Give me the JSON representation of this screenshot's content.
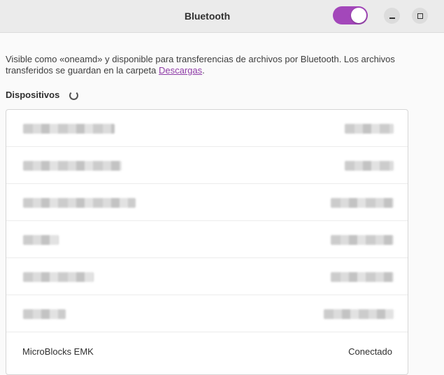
{
  "window": {
    "title": "Bluetooth",
    "toggle_state": "on",
    "accent_color": "#a347ba"
  },
  "description": {
    "text_before_link": "Visible como «oneamd» y disponible para transferencias de archivos por Bluetooth. Los archivos transferidos se guardan en la carpeta ",
    "link_label": "Descargas",
    "text_after_link": "."
  },
  "devices": {
    "heading": "Dispositivos",
    "items": [
      {
        "name": "MicroBlocks EMK",
        "status": "Conectado"
      }
    ]
  }
}
